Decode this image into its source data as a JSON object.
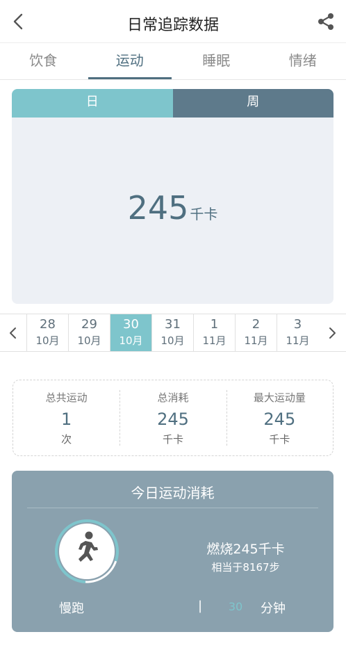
{
  "header": {
    "title": "日常追踪数据",
    "back_icon": "chevron-left-icon",
    "share_icon": "share-icon"
  },
  "tabs": [
    {
      "label": "饮食",
      "active": false
    },
    {
      "label": "运动",
      "active": true
    },
    {
      "label": "睡眠",
      "active": false
    },
    {
      "label": "情绪",
      "active": false
    }
  ],
  "period_toggle": {
    "day_label": "日",
    "week_label": "周",
    "selected": "日"
  },
  "summary": {
    "value": "245",
    "unit": "千卡"
  },
  "date_strip": {
    "prev_icon": "chevron-left-icon",
    "next_icon": "chevron-right-icon",
    "dates": [
      {
        "day": "28",
        "month": "10月",
        "selected": false
      },
      {
        "day": "29",
        "month": "10月",
        "selected": false
      },
      {
        "day": "30",
        "month": "10月",
        "selected": true
      },
      {
        "day": "31",
        "month": "10月",
        "selected": false
      },
      {
        "day": "1",
        "month": "11月",
        "selected": false
      },
      {
        "day": "2",
        "month": "11月",
        "selected": false
      },
      {
        "day": "3",
        "month": "11月",
        "selected": false
      }
    ]
  },
  "stats": [
    {
      "label": "总共运动",
      "value": "1",
      "unit": "次"
    },
    {
      "label": "总消耗",
      "value": "245",
      "unit": "千卡"
    },
    {
      "label": "最大运动量",
      "value": "245",
      "unit": "千卡"
    }
  ],
  "today": {
    "title": "今日运动消耗",
    "activity_icon": "running-person-icon",
    "burn_text": "燃烧245千卡",
    "equivalent_text": "相当于8167步",
    "activity_name": "慢跑",
    "separator": "|",
    "minutes_value": "30",
    "minutes_unit": "分钟",
    "ring_progress": 0.78
  },
  "colors": {
    "accent": "#7ec5cc",
    "dark": "#5e7a8b",
    "card": "#8aa1ae"
  }
}
